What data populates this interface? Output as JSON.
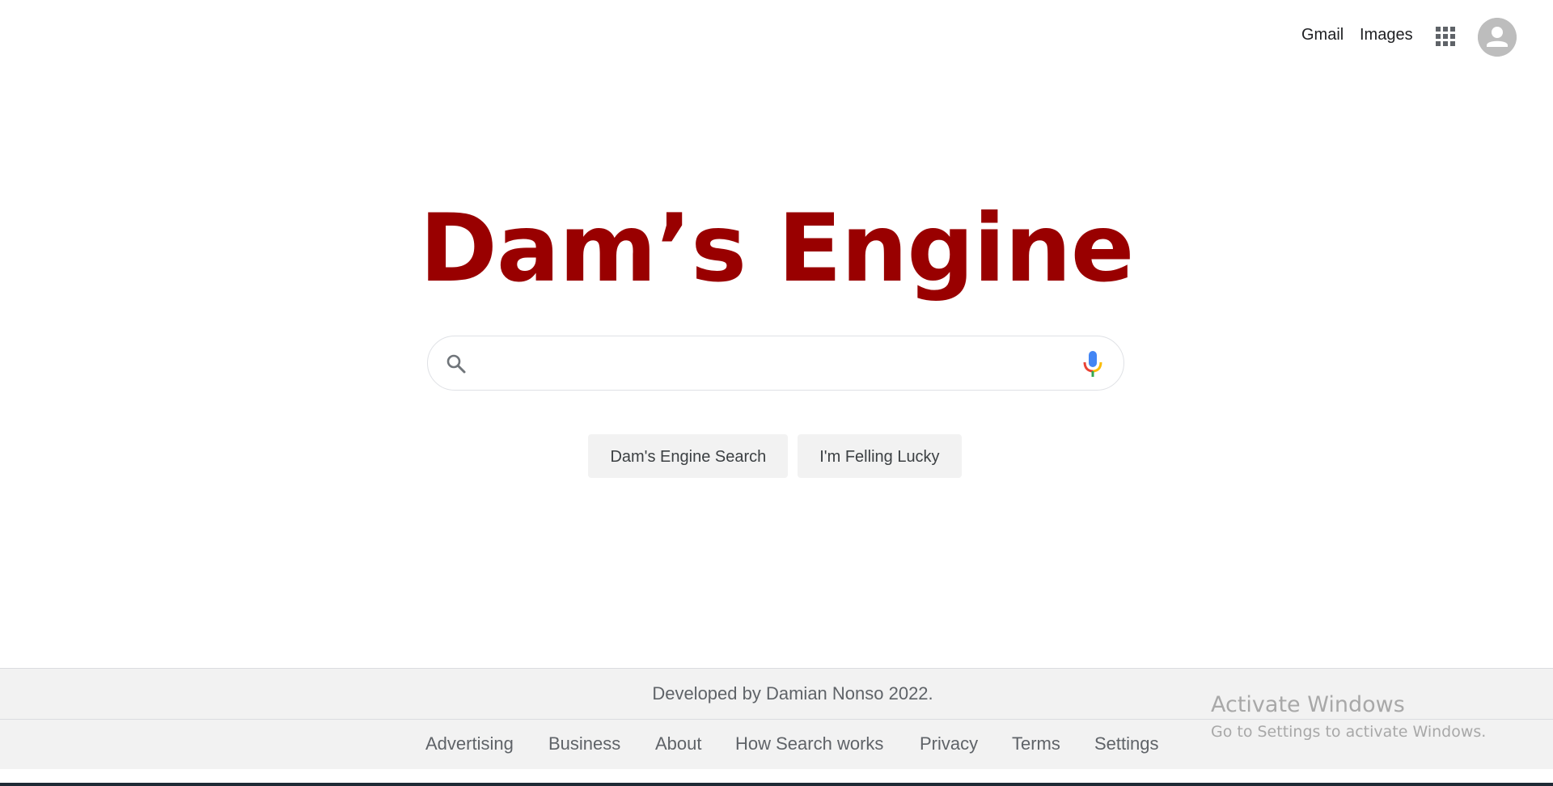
{
  "header": {
    "gmail_label": "Gmail",
    "images_label": "Images",
    "apps_icon": "apps-grid-icon",
    "avatar_icon": "account-avatar-icon"
  },
  "logo": {
    "text": "Dam’s Engine",
    "color": "#990000"
  },
  "search": {
    "value": "",
    "placeholder": "",
    "search_icon": "search-icon",
    "mic_icon": "microphone-icon"
  },
  "buttons": {
    "search_label": "Dam's Engine Search",
    "lucky_label": "I'm Felling Lucky"
  },
  "footer": {
    "developer_text": "Developed by Damian Nonso 2022.",
    "links": [
      "Advertising",
      "Business",
      "About",
      "How Search works",
      "Privacy",
      "Terms",
      "Settings"
    ]
  },
  "watermark": {
    "title": "Activate Windows",
    "subtitle": "Go to Settings to activate Windows."
  }
}
